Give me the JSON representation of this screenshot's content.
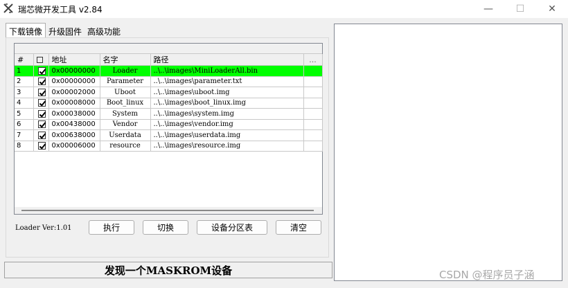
{
  "window": {
    "title": "瑞芯微开发工具 v2.84",
    "minimize_glyph": "—",
    "maximize_glyph": "☐",
    "close_glyph": "✕"
  },
  "tabs": [
    {
      "label": "下载镜像",
      "active": true
    },
    {
      "label": "升级固件",
      "active": false
    },
    {
      "label": "高级功能",
      "active": false
    }
  ],
  "table": {
    "headers": {
      "no": "#",
      "address": "地址",
      "name": "名字",
      "path": "路径",
      "more": "..."
    },
    "rows": [
      {
        "no": "1",
        "checked": true,
        "address": "0x00000000",
        "name": "Loader",
        "path": "..\\..\\images\\MiniLoaderAll.bin",
        "selected": true
      },
      {
        "no": "2",
        "checked": true,
        "address": "0x00000000",
        "name": "Parameter",
        "path": "..\\..\\images\\parameter.txt",
        "selected": false
      },
      {
        "no": "3",
        "checked": true,
        "address": "0x00002000",
        "name": "Uboot",
        "path": "..\\..\\images\\uboot.img",
        "selected": false
      },
      {
        "no": "4",
        "checked": true,
        "address": "0x00008000",
        "name": "Boot_linux",
        "path": "..\\..\\images\\boot_linux.img",
        "selected": false
      },
      {
        "no": "5",
        "checked": true,
        "address": "0x00038000",
        "name": "System",
        "path": "..\\..\\images\\system.img",
        "selected": false
      },
      {
        "no": "6",
        "checked": true,
        "address": "0x00438000",
        "name": "Vendor",
        "path": "..\\..\\images\\vendor.img",
        "selected": false
      },
      {
        "no": "7",
        "checked": true,
        "address": "0x00638000",
        "name": "Userdata",
        "path": "..\\..\\images\\userdata.img",
        "selected": false
      },
      {
        "no": "8",
        "checked": true,
        "address": "0x00006000",
        "name": "resource",
        "path": "..\\..\\images\\resource.img",
        "selected": false
      }
    ]
  },
  "loader_version": "Loader Ver:1.01",
  "buttons": {
    "run": "执行",
    "switch": "切换",
    "partition_table": "设备分区表",
    "clear": "清空"
  },
  "status": "发现一个MASKROM设备",
  "watermark": "CSDN @程序员子涵",
  "colors": {
    "selected_row": "#00ff00",
    "window_bg": "#f0f0f0"
  },
  "icons": {
    "app": "rockchip-tool-icon",
    "checkbox_checked": "checkmark-icon"
  }
}
